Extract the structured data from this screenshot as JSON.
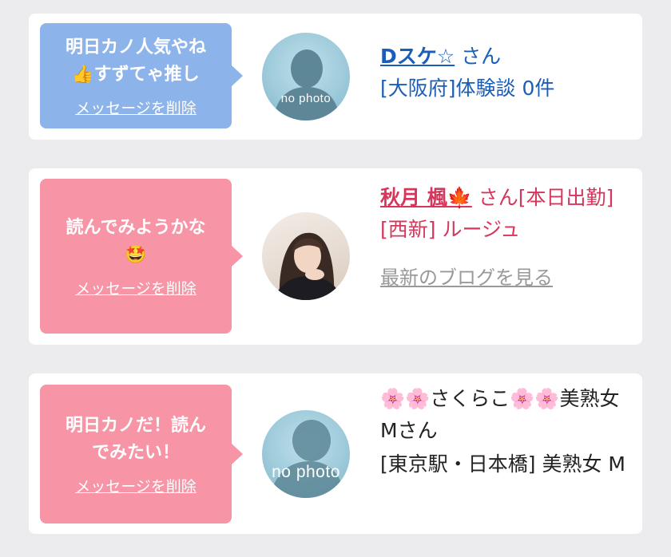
{
  "cards": [
    {
      "bubble_line1": "明日カノ人気やね",
      "bubble_line2": "👍すずてゃ推し",
      "delete_label": "メッセージを削除",
      "avatar_label": "no photo",
      "name": "Dスケ☆",
      "suffix": " さん",
      "detail": "[大阪府]体験談 0件"
    },
    {
      "bubble_line1": "読んでみようかな",
      "bubble_line2": "🤩",
      "delete_label": "メッセージを削除",
      "name": "秋月 楓🍁",
      "suffix": " さん[本日出勤]",
      "detail": "[西新] ルージュ",
      "blog_link": "最新のブログを見る"
    },
    {
      "bubble_line1": "明日カノだ！読ん",
      "bubble_line2": "でみたい！",
      "delete_label": "メッセージを削除",
      "avatar_label": "no photo",
      "name": "🌸🌸さくらこ🌸🌸美熟女Mさん",
      "detail": "[東京駅・日本橋] 美熟女 M"
    }
  ]
}
